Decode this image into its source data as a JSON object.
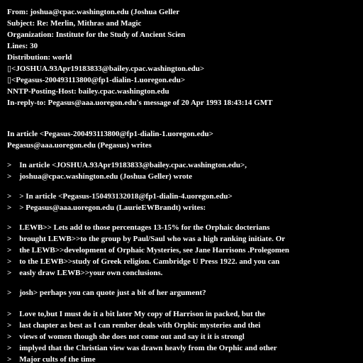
{
  "message": {
    "header_lines": [
      "From: joshua@cpac.washington.edu (Joshua Geller",
      "Subject: Re: Merlin, Mithras and Magic",
      "Organization: Institute for the Study of Ancient Scien",
      "Lines: 30",
      "Distribution: world",
      "▯<JOSHUA.93Apr19183833@bailey.cpac.washington.edu>",
      "▯<Pegasus-200493113800@fp1-dialin-1.uoregon.edu>",
      "NNTP-Posting-Host: bailey.cpac.washington.edu",
      "In-reply-to: Pegasus@aaa.uoregon.edu's message of 20 Apr 1993 18:43:14 GMT"
    ],
    "intro_lines": [
      "In article <Pegasus-200493113800@fp1-dialin-1.uoregon.edu>",
      "Pegasus@aaa.uoregon.edu (Pegasus) writes"
    ],
    "quote_block_1": [
      ">    In article <JOSHUA.93Apr19183833@bailey.cpac.washington.edu>,",
      ">    joshua@cpac.washington.edu (Joshua Geller) wrote"
    ],
    "quote_block_2": [
      ">    > In article <Pegasus-150493132018@fp1-dialin-4.uoregon.edu>",
      ">    > Pegasus@aaa.uoregon.edu (LaurieEWBrandt) writes:"
    ],
    "quote_block_3": [
      ">    LEWB>> Lets add to those percentages 13-15% for the Orphaic docterians",
      ">    brought LEWB>>to the group by Paul/Saul who was a high ranking initiate. Or",
      ">    the LEWB>>development of Orphaic Mysteries, see Jane Harrisons .Prolegomen",
      ">    to the LEWB>>study of Greek religion. Cambridge U Press 1922. and you can",
      ">    easly draw LEWB>>your own conclusions."
    ],
    "quote_block_4": [
      ">    josh> perhaps you can quote just a bit of her argument?"
    ],
    "quote_block_5": [
      ">    Love to,but I must do it a bit later My copy of Harrison in packed, but the",
      ">    last chapter as best as I can rember deals with Orphic mysteries and thei",
      ">    views of women though she does not come out and say it it is strongl",
      ">    implyed that the Christian view was drawn heavly from the Orphic and other",
      ">    Major cults of the time"
    ]
  }
}
